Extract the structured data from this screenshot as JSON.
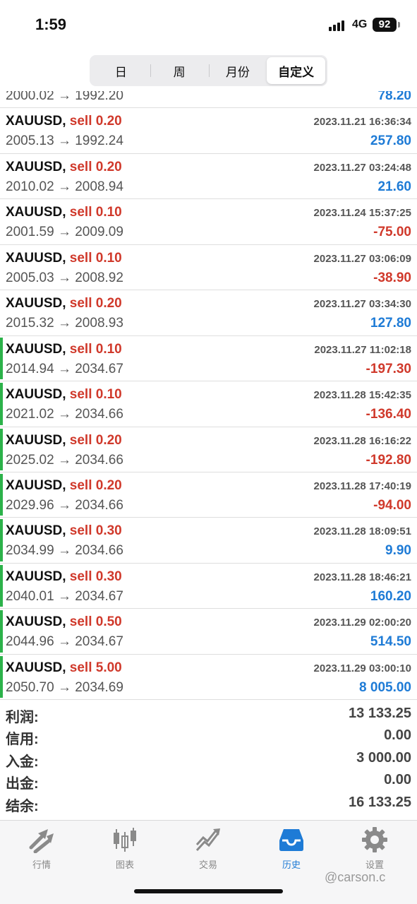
{
  "status_bar": {
    "time": "1:59",
    "network": "4G",
    "battery": "92"
  },
  "segments": [
    {
      "label": "日",
      "active": false
    },
    {
      "label": "周",
      "active": false
    },
    {
      "label": "月份",
      "active": false
    },
    {
      "label": "自定义",
      "active": true
    }
  ],
  "partial_row": {
    "price": "2000.02 → 1992.20",
    "profit": "78.20"
  },
  "trades": [
    {
      "symbol": "XAUUSD,",
      "side": "sell 0.20",
      "time": "2023.11.21 16:36:34",
      "price": "2005.13 → 1992.24",
      "profit": "257.80",
      "positive": true,
      "marked": false
    },
    {
      "symbol": "XAUUSD,",
      "side": "sell 0.20",
      "time": "2023.11.27 03:24:48",
      "price": "2010.02 → 2008.94",
      "profit": "21.60",
      "positive": true,
      "marked": false
    },
    {
      "symbol": "XAUUSD,",
      "side": "sell 0.10",
      "time": "2023.11.24 15:37:25",
      "price": "2001.59 → 2009.09",
      "profit": "-75.00",
      "positive": false,
      "marked": false
    },
    {
      "symbol": "XAUUSD,",
      "side": "sell 0.10",
      "time": "2023.11.27 03:06:09",
      "price": "2005.03 → 2008.92",
      "profit": "-38.90",
      "positive": false,
      "marked": false
    },
    {
      "symbol": "XAUUSD,",
      "side": "sell 0.20",
      "time": "2023.11.27 03:34:30",
      "price": "2015.32 → 2008.93",
      "profit": "127.80",
      "positive": true,
      "marked": false
    },
    {
      "symbol": "XAUUSD,",
      "side": "sell 0.10",
      "time": "2023.11.27 11:02:18",
      "price": "2014.94 → 2034.67",
      "profit": "-197.30",
      "positive": false,
      "marked": true
    },
    {
      "symbol": "XAUUSD,",
      "side": "sell 0.10",
      "time": "2023.11.28 15:42:35",
      "price": "2021.02 → 2034.66",
      "profit": "-136.40",
      "positive": false,
      "marked": true
    },
    {
      "symbol": "XAUUSD,",
      "side": "sell 0.20",
      "time": "2023.11.28 16:16:22",
      "price": "2025.02 → 2034.66",
      "profit": "-192.80",
      "positive": false,
      "marked": true
    },
    {
      "symbol": "XAUUSD,",
      "side": "sell 0.20",
      "time": "2023.11.28 17:40:19",
      "price": "2029.96 → 2034.66",
      "profit": "-94.00",
      "positive": false,
      "marked": true
    },
    {
      "symbol": "XAUUSD,",
      "side": "sell 0.30",
      "time": "2023.11.28 18:09:51",
      "price": "2034.99 → 2034.66",
      "profit": "9.90",
      "positive": true,
      "marked": true
    },
    {
      "symbol": "XAUUSD,",
      "side": "sell 0.30",
      "time": "2023.11.28 18:46:21",
      "price": "2040.01 → 2034.67",
      "profit": "160.20",
      "positive": true,
      "marked": true
    },
    {
      "symbol": "XAUUSD,",
      "side": "sell 0.50",
      "time": "2023.11.29 02:00:20",
      "price": "2044.96 → 2034.67",
      "profit": "514.50",
      "positive": true,
      "marked": true
    },
    {
      "symbol": "XAUUSD,",
      "side": "sell 5.00",
      "time": "2023.11.29 03:00:10",
      "price": "2050.70 → 2034.69",
      "profit": "8 005.00",
      "positive": true,
      "marked": true
    }
  ],
  "summary": [
    {
      "label": "利润:",
      "value": "13 133.25"
    },
    {
      "label": "信用:",
      "value": "0.00"
    },
    {
      "label": "入金:",
      "value": "3 000.00"
    },
    {
      "label": "出金:",
      "value": "0.00"
    },
    {
      "label": "结余:",
      "value": "16 133.25"
    }
  ],
  "tabs": [
    {
      "label": "行情",
      "icon": "quotes-arrows-icon",
      "active": false
    },
    {
      "label": "图表",
      "icon": "candlestick-chart-icon",
      "active": false
    },
    {
      "label": "交易",
      "icon": "trade-trend-icon",
      "active": false
    },
    {
      "label": "历史",
      "icon": "history-inbox-icon",
      "active": true
    },
    {
      "label": "设置",
      "icon": "gear-icon",
      "active": false
    }
  ],
  "watermark": "@carson.c",
  "colors": {
    "profit_positive": "#1e7bd6",
    "profit_negative": "#d0392b",
    "sell": "#d0392b",
    "marker": "#2cb24a",
    "tab_active": "#1e7bd6",
    "tab_inactive": "#888888"
  }
}
